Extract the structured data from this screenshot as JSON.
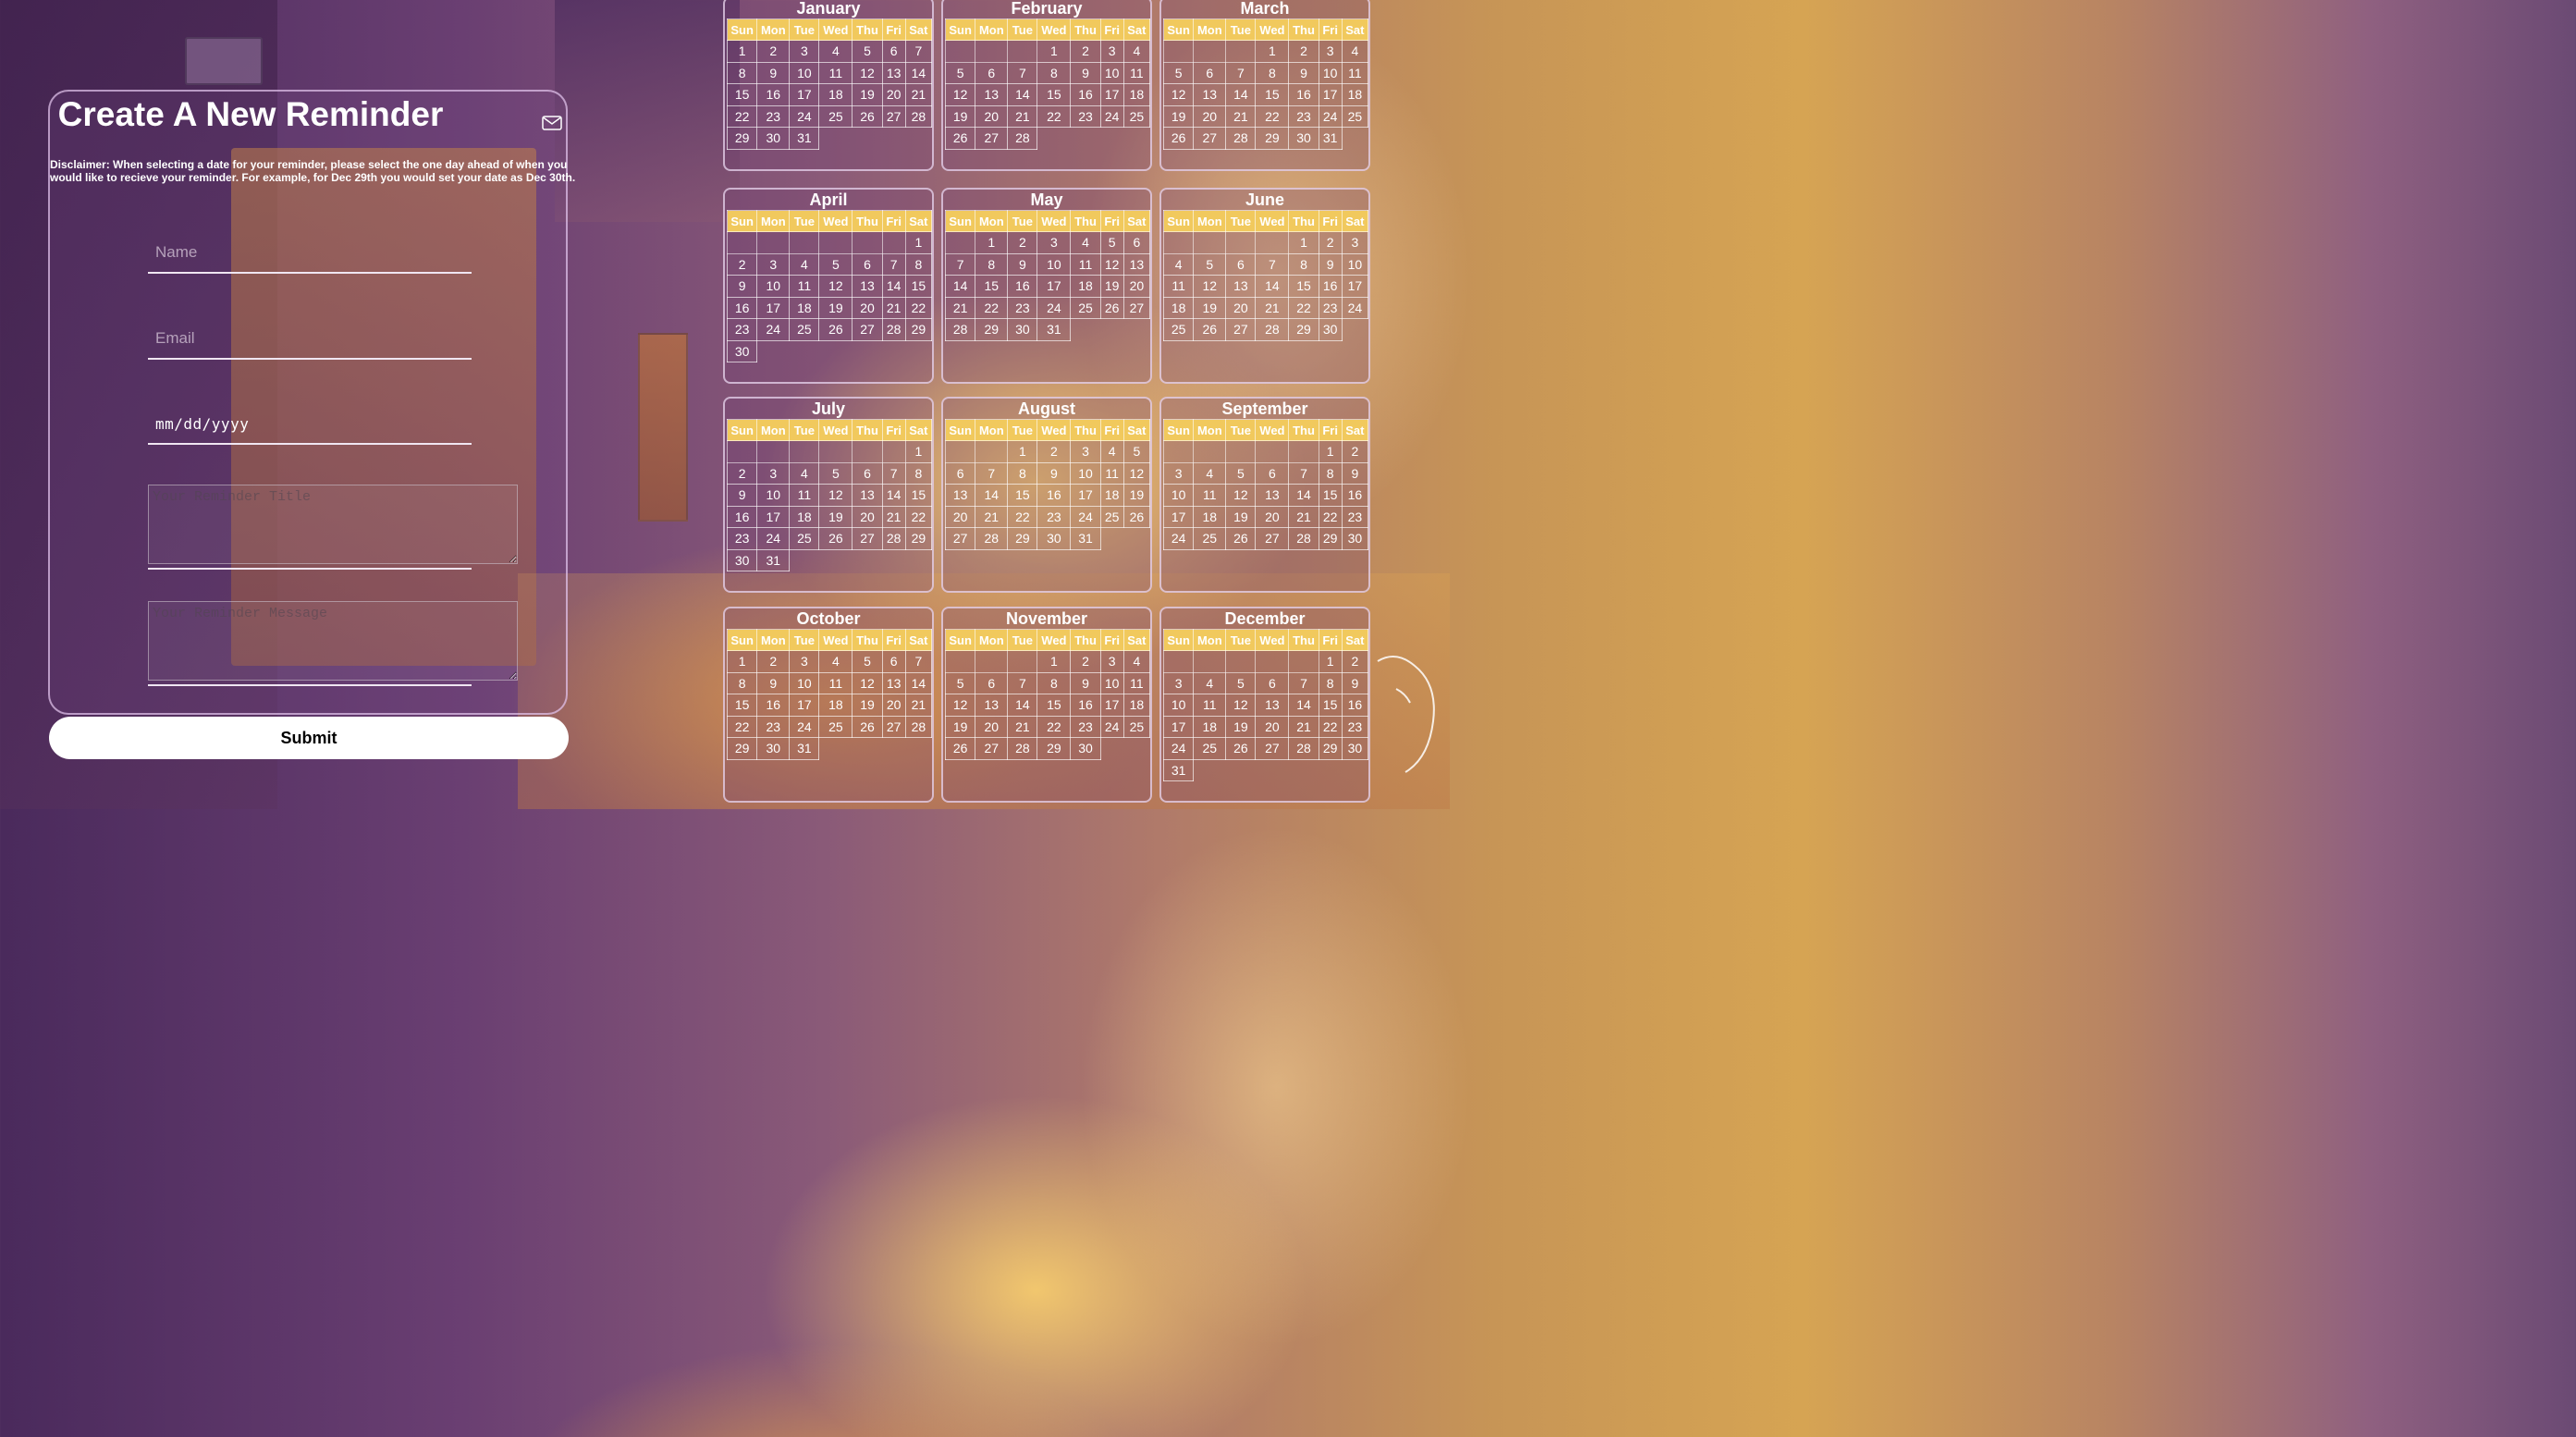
{
  "form": {
    "title": "Create A New Reminder",
    "mail_icon": "envelope-icon",
    "disclaimer": "Disclaimer: When selecting a date for your reminder, please select the one day ahead of when you would like to recieve your reminder. For example, for Dec 29th you would set your date as Dec 30th.",
    "name_placeholder": "Name",
    "email_placeholder": "Email",
    "date_placeholder": "mm/dd/yyyy",
    "title_placeholder": "Your Reminder Title",
    "message_placeholder": "Your Reminder Message",
    "submit_label": "Submit"
  },
  "calendar": {
    "weekdays": [
      "Sun",
      "Mon",
      "Tue",
      "Wed",
      "Thu",
      "Fri",
      "Sat"
    ],
    "months": [
      {
        "name": "January",
        "offset": 0,
        "days": 31
      },
      {
        "name": "February",
        "offset": 3,
        "days": 28
      },
      {
        "name": "March",
        "offset": 3,
        "days": 31
      },
      {
        "name": "April",
        "offset": 6,
        "days": 30
      },
      {
        "name": "May",
        "offset": 1,
        "days": 31
      },
      {
        "name": "June",
        "offset": 4,
        "days": 30
      },
      {
        "name": "July",
        "offset": 6,
        "days": 31
      },
      {
        "name": "August",
        "offset": 2,
        "days": 31
      },
      {
        "name": "September",
        "offset": 5,
        "days": 30
      },
      {
        "name": "October",
        "offset": 0,
        "days": 31
      },
      {
        "name": "November",
        "offset": 3,
        "days": 30
      },
      {
        "name": "December",
        "offset": 5,
        "days": 31
      }
    ]
  }
}
